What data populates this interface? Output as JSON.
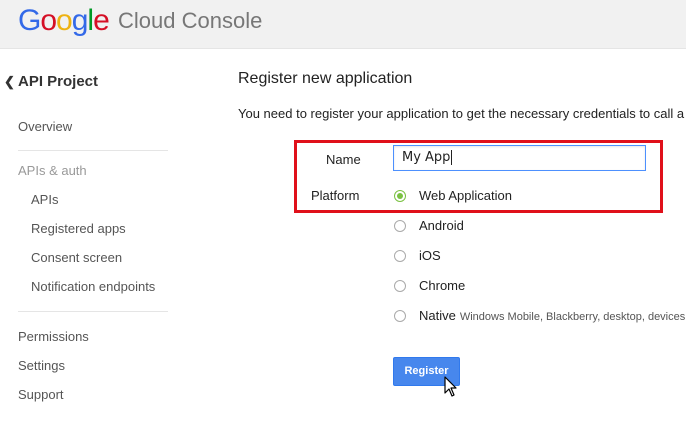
{
  "header": {
    "logo_letters": [
      "G",
      "o",
      "o",
      "g",
      "l",
      "e"
    ],
    "product_name": "Cloud Console"
  },
  "sidebar": {
    "back_label": "API Project",
    "items": [
      {
        "label": "Overview"
      },
      {
        "label": "APIs & auth"
      },
      {
        "label": "APIs"
      },
      {
        "label": "Registered apps"
      },
      {
        "label": "Consent screen"
      },
      {
        "label": "Notification endpoints"
      },
      {
        "label": "Permissions"
      },
      {
        "label": "Settings"
      },
      {
        "label": "Support"
      }
    ]
  },
  "main": {
    "title": "Register new application",
    "description": "You need to register your application to get the necessary credentials to call a",
    "name_label": "Name",
    "name_value": "My App",
    "platform_label": "Platform",
    "platforms": [
      {
        "label": "Web Application",
        "checked": true
      },
      {
        "label": "Android",
        "checked": false
      },
      {
        "label": "iOS",
        "checked": false
      },
      {
        "label": "Chrome",
        "checked": false
      },
      {
        "label": "Native",
        "sublabel": "Windows Mobile, Blackberry, desktop, devices, ar",
        "checked": false
      }
    ],
    "register_label": "Register"
  },
  "colors": {
    "highlight": "#e0101a",
    "button": "#4787ed",
    "radio_checked": "#7ac142"
  }
}
